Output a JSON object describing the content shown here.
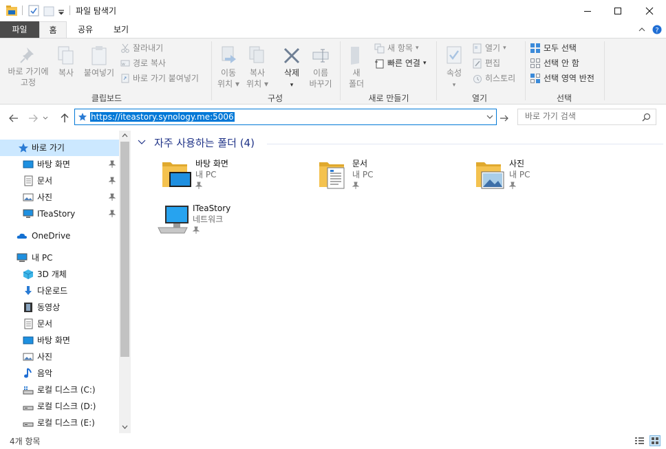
{
  "window": {
    "title": "파일 탐색기"
  },
  "ribbon_tabs": [
    "파일",
    "홈",
    "공유",
    "보기"
  ],
  "ribbon": {
    "clipboard": {
      "pin_line1": "바로 가기에",
      "pin_line2": "고정",
      "copy": "복사",
      "paste": "붙여넣기",
      "cut": "잘라내기",
      "copy_path": "경로 복사",
      "paste_shortcut": "바로 가기 붙여넣기",
      "label": "클립보드"
    },
    "organize": {
      "move_line1": "이동",
      "move_line2": "위치",
      "copy_line1": "복사",
      "copy_line2": "위치",
      "delete": "삭제",
      "rename_line1": "이름",
      "rename_line2": "바꾸기",
      "label": "구성"
    },
    "new": {
      "new_folder_line1": "새",
      "new_folder_line2": "폴더",
      "new_item": "새 항목",
      "easy_access": "빠른 연결",
      "label": "새로 만들기"
    },
    "open": {
      "properties": "속성",
      "open": "열기",
      "edit": "편집",
      "history": "히스토리",
      "label": "열기"
    },
    "select": {
      "select_all": "모두 선택",
      "select_none": "선택 안 함",
      "invert": "선택 영역 반전",
      "label": "선택"
    }
  },
  "address": {
    "value": "https://iteastory.synology.me:5006",
    "search_placeholder": "바로 가기 검색"
  },
  "nav": {
    "quick_access": "바로 가기",
    "pinned": [
      {
        "label": "바탕 화면",
        "icon": "desktop-icon"
      },
      {
        "label": "문서",
        "icon": "documents-icon"
      },
      {
        "label": "사진",
        "icon": "pictures-icon"
      },
      {
        "label": "ITeaStory",
        "icon": "computer-icon"
      }
    ],
    "onedrive": "OneDrive",
    "this_pc": "내 PC",
    "pc_items": [
      {
        "label": "3D 개체",
        "icon": "3d-objects-icon"
      },
      {
        "label": "다운로드",
        "icon": "download-icon"
      },
      {
        "label": "동영상",
        "icon": "video-icon"
      },
      {
        "label": "문서",
        "icon": "documents-icon"
      },
      {
        "label": "바탕 화면",
        "icon": "desktop-icon"
      },
      {
        "label": "사진",
        "icon": "pictures-icon"
      },
      {
        "label": "음악",
        "icon": "music-icon"
      },
      {
        "label": "로컬 디스크 (C:)",
        "icon": "drive-c-icon"
      },
      {
        "label": "로컬 디스크 (D:)",
        "icon": "drive-icon"
      },
      {
        "label": "로컬 디스크 (E:)",
        "icon": "drive-icon"
      }
    ]
  },
  "content": {
    "group_title": "자주 사용하는 폴더 (4)",
    "items": [
      {
        "name": "바탕 화면",
        "location": "내 PC"
      },
      {
        "name": "문서",
        "location": "내 PC"
      },
      {
        "name": "사진",
        "location": "내 PC"
      },
      {
        "name": "ITeaStory",
        "location": "네트워크"
      }
    ]
  },
  "status": {
    "count": "4개 항목"
  },
  "colors": {
    "accent": "#0078d7",
    "file_tab": "#4b4b4b",
    "group_title": "#1e3287",
    "folder": "#f4c24f"
  }
}
